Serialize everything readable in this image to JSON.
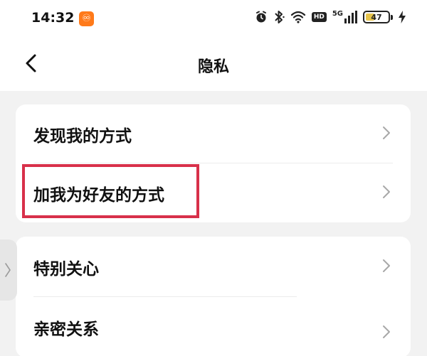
{
  "status_bar": {
    "time": "14:32",
    "app_icon": "notification-app-icon",
    "network_label": "5G",
    "hd_label": "HD",
    "battery_level": "47",
    "icons": [
      "alarm-icon",
      "bluetooth-icon",
      "wifi-icon",
      "hd-icon",
      "signal-icon",
      "battery-icon",
      "charging-icon"
    ]
  },
  "header": {
    "title": "隐私",
    "back_icon": "chevron-left-icon"
  },
  "sections": [
    {
      "items": [
        {
          "label": "发现我的方式",
          "arrow_icon": "chevron-right-icon"
        },
        {
          "label": "加我为好友的方式",
          "arrow_icon": "chevron-right-icon",
          "highlighted": true
        }
      ]
    },
    {
      "items": [
        {
          "label": "特别关心",
          "arrow_icon": "chevron-right-icon"
        },
        {
          "label": "亲密关系",
          "arrow_icon": "chevron-right-icon"
        }
      ]
    }
  ],
  "colors": {
    "background": "#f2f2f2",
    "card": "#ffffff",
    "highlight": "#d8304a",
    "app_icon": "#ff7a1a",
    "battery_fill": "#e7c44c"
  }
}
